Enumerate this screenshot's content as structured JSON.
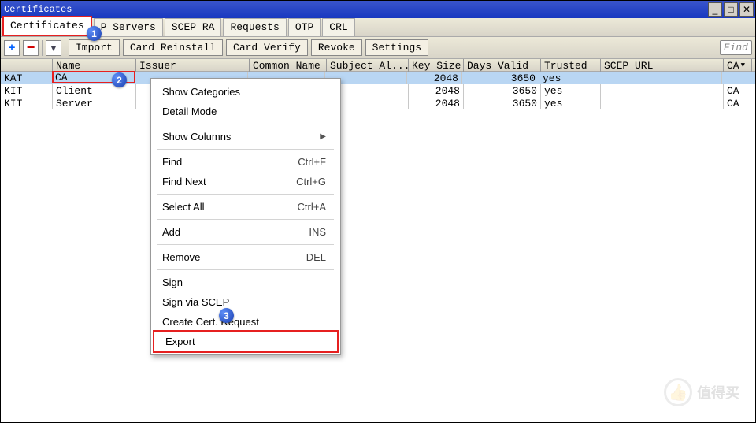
{
  "window": {
    "title": "Certificates",
    "controls": {
      "minimize": "_",
      "maximize": "□",
      "close": "✕"
    }
  },
  "tabs": [
    "Certificates",
    "P Servers",
    "SCEP RA",
    "Requests",
    "OTP",
    "CRL"
  ],
  "toolbar": {
    "icons": {
      "add": "+",
      "remove": "−",
      "filter": "▼"
    },
    "buttons": [
      "Import",
      "Card Reinstall",
      "Card Verify",
      "Revoke",
      "Settings"
    ],
    "find_placeholder": "Find"
  },
  "columns": [
    "",
    "Name",
    "Issuer",
    "Common Name",
    "Subject Al...",
    "Key Size",
    "Days Valid",
    "Trusted",
    "SCEP URL",
    "CA"
  ],
  "rows": [
    {
      "c0": "KAT",
      "c1": "CA",
      "c2": "",
      "c3": "",
      "c4": "",
      "c5": "2048",
      "c6": "3650",
      "c7": "yes",
      "c8": "",
      "c9": "",
      "selected": true
    },
    {
      "c0": "KIT",
      "c1": "Client",
      "c2": "",
      "c3": "",
      "c4": "",
      "c5": "2048",
      "c6": "3650",
      "c7": "yes",
      "c8": "",
      "c9": "CA"
    },
    {
      "c0": "KIT",
      "c1": "Server",
      "c2": "",
      "c3": "",
      "c4": "",
      "c5": "2048",
      "c6": "3650",
      "c7": "yes",
      "c8": "",
      "c9": "CA"
    }
  ],
  "context_menu": [
    {
      "label": "Show Categories"
    },
    {
      "label": "Detail Mode"
    },
    "sep",
    {
      "label": "Show Columns",
      "submenu": true
    },
    "sep",
    {
      "label": "Find",
      "shortcut": "Ctrl+F"
    },
    {
      "label": "Find Next",
      "shortcut": "Ctrl+G"
    },
    "sep",
    {
      "label": "Select All",
      "shortcut": "Ctrl+A"
    },
    "sep",
    {
      "label": "Add",
      "shortcut": "INS"
    },
    "sep",
    {
      "label": "Remove",
      "shortcut": "DEL"
    },
    "sep",
    {
      "label": "Sign"
    },
    {
      "label": "Sign via SCEP"
    },
    {
      "label": "Create Cert. Request"
    },
    {
      "label": "Export",
      "highlighted": true
    }
  ],
  "markers": {
    "m1": "1",
    "m2": "2",
    "m3": "3"
  },
  "watermark": {
    "icon": "👍",
    "text": "值得买"
  }
}
